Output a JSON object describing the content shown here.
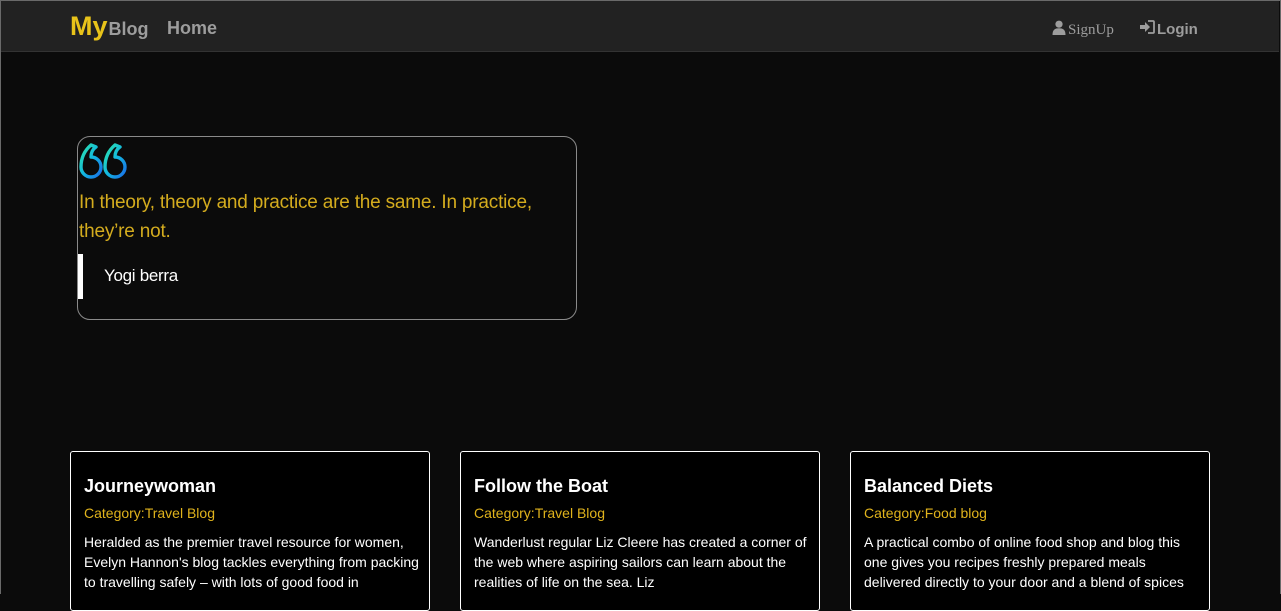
{
  "navbar": {
    "brand_my": "My",
    "brand_blog": "Blog",
    "home_label": "Home",
    "signup_label": "SignUp",
    "login_label": "Login"
  },
  "quote": {
    "text": "In theory, theory and practice are the same. In practice, they’re not.",
    "author": "Yogi berra"
  },
  "cards": [
    {
      "title": "Journeywoman",
      "category": "Category:Travel Blog",
      "description": "Heralded as the premier travel resource for women, Evelyn Hannon's blog tackles everything from packing to travelling safely – with lots of good food in"
    },
    {
      "title": "Follow the Boat",
      "category": "Category:Travel Blog",
      "description": "Wanderlust regular Liz Cleere has created a corner of the web where aspiring sailors can learn about the realities of life on the sea. Liz"
    },
    {
      "title": "Balanced Diets",
      "category": "Category:Food blog",
      "description": "A practical combo of online food shop and blog this one gives you recipes freshly prepared meals delivered directly to your door and a blend of spices"
    }
  ],
  "colors": {
    "brand_accent": "#e8c31a",
    "quote_text": "#d4ac1e",
    "category_text": "#e0b31c",
    "navbar_bg": "#222222",
    "page_bg": "#0b0b0b"
  }
}
